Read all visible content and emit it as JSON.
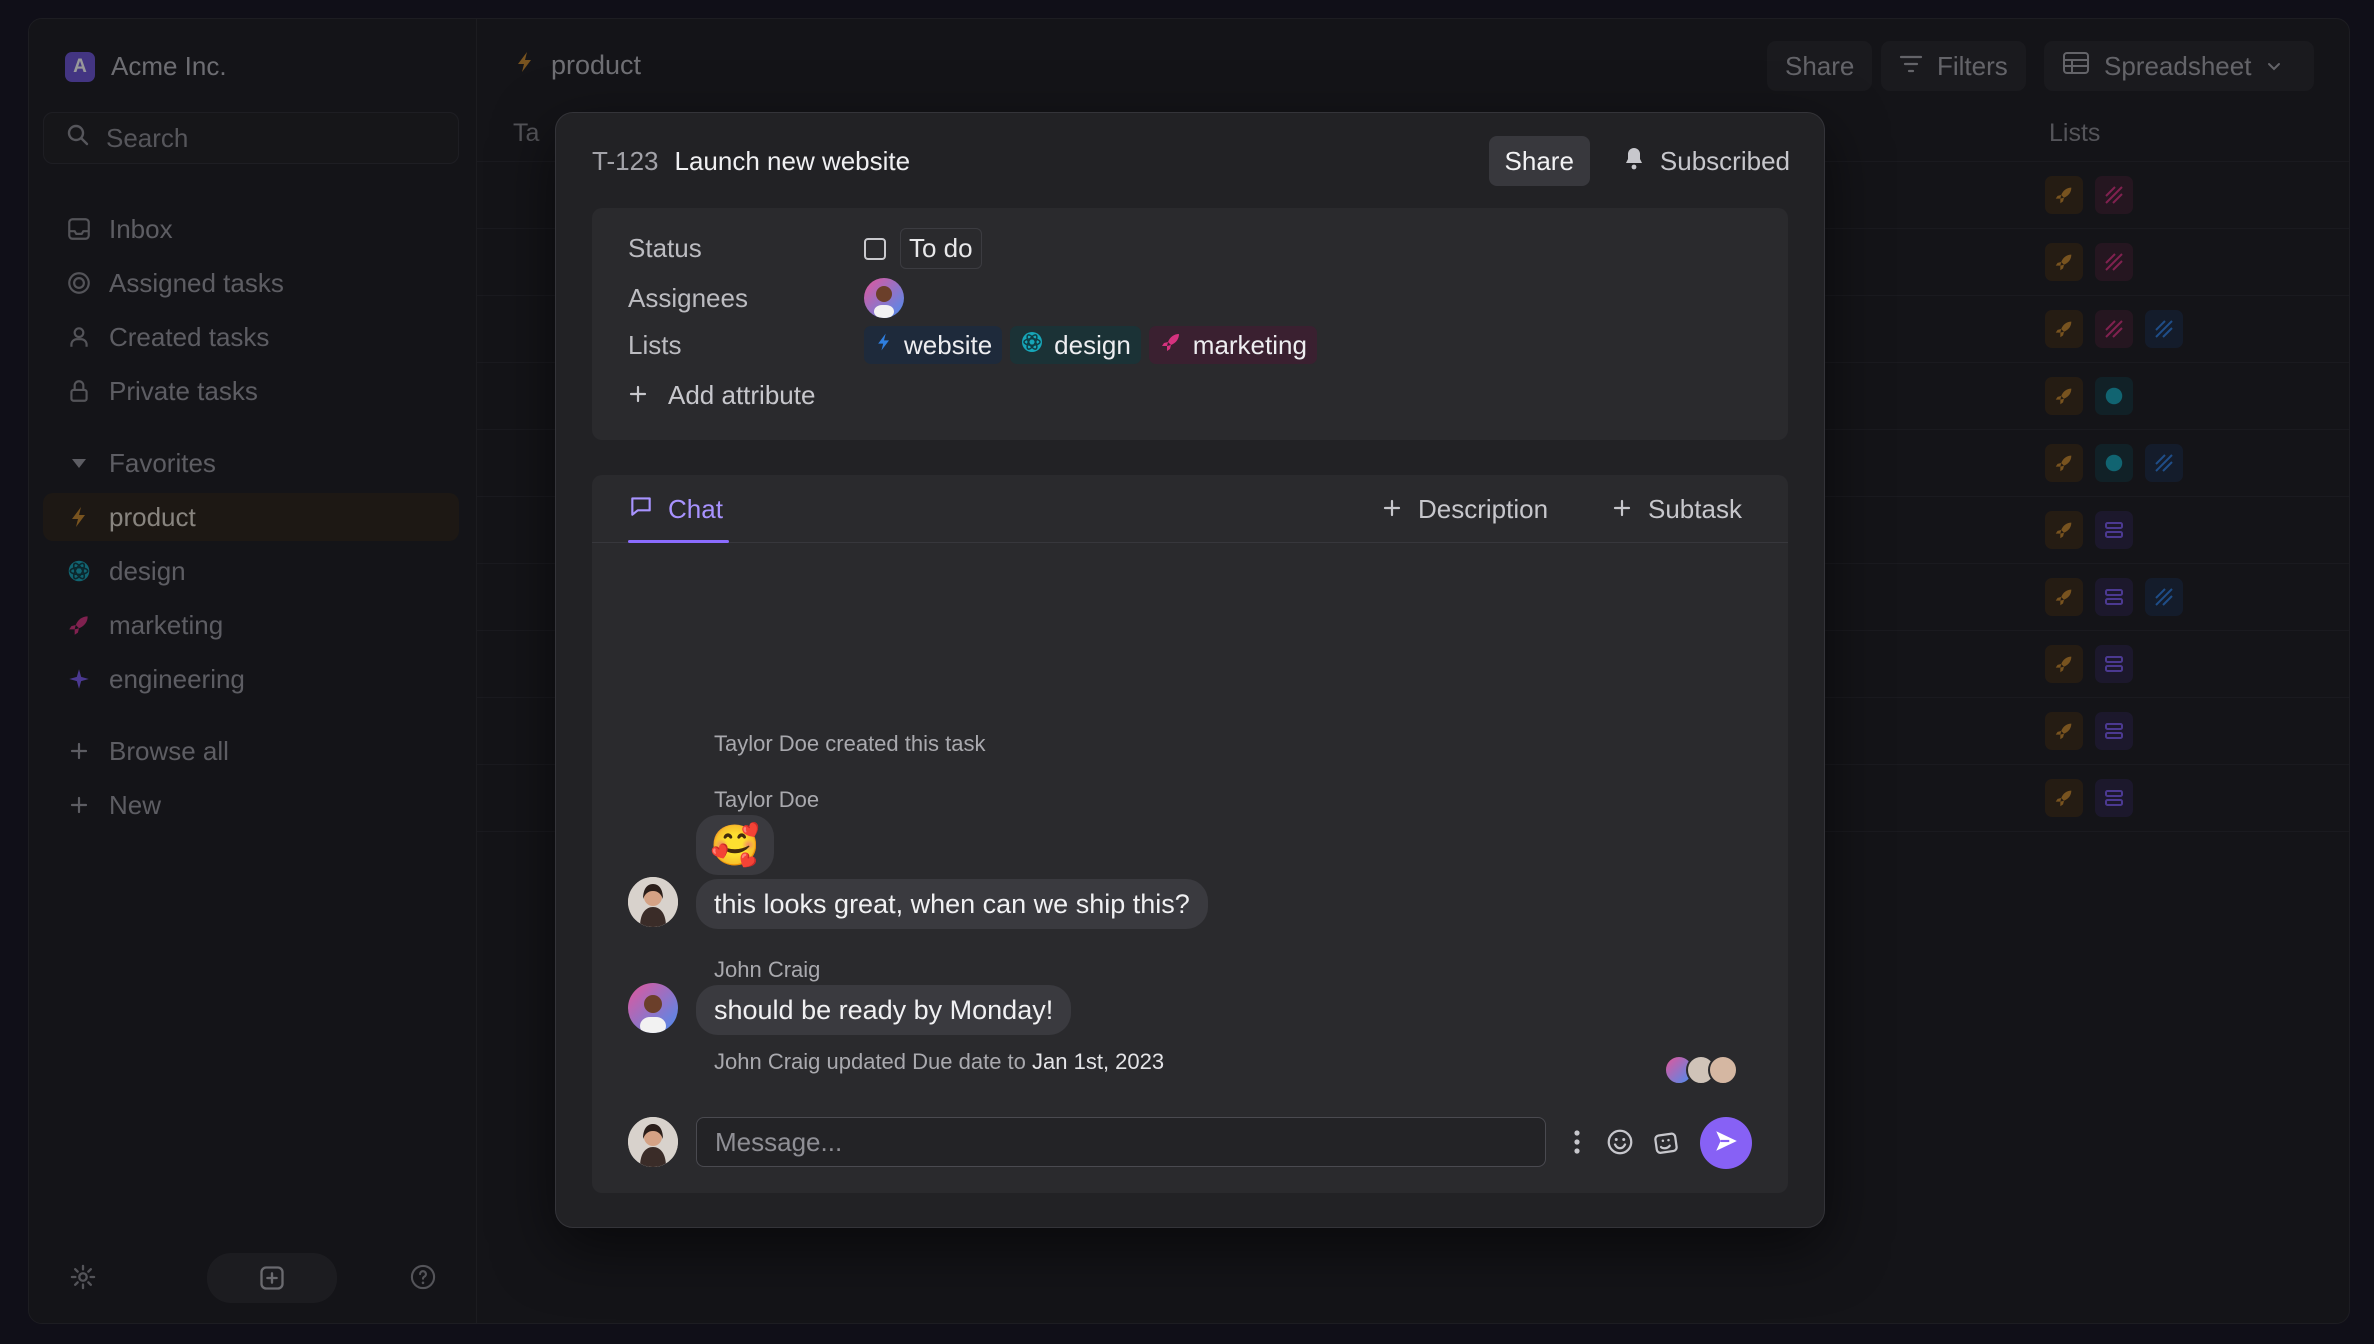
{
  "workspace": {
    "initial": "A",
    "name": "Acme Inc."
  },
  "sidebar": {
    "search_placeholder": "Search",
    "nav": [
      {
        "label": "Inbox",
        "icon": "inbox-icon"
      },
      {
        "label": "Assigned tasks",
        "icon": "target-icon"
      },
      {
        "label": "Created tasks",
        "icon": "user-icon"
      },
      {
        "label": "Private tasks",
        "icon": "lock-icon"
      }
    ],
    "favorites_label": "Favorites",
    "favorites": [
      {
        "label": "product",
        "icon": "bolt-icon",
        "color": "#c9892c"
      },
      {
        "label": "design",
        "icon": "atom-icon",
        "color": "#17a6b8"
      },
      {
        "label": "marketing",
        "icon": "rocket-icon",
        "color": "#d6327f"
      },
      {
        "label": "engineering",
        "icon": "sparkle-icon",
        "color": "#7b5cf0"
      }
    ],
    "browse_all": "Browse all",
    "new": "New"
  },
  "main": {
    "breadcrumb": "product",
    "share": "Share",
    "filters": "Filters",
    "view": "Spreadsheet",
    "col_tasks": "Ta",
    "col_lists": "Lists"
  },
  "task": {
    "id": "T-123",
    "title": "Launch new website",
    "share": "Share",
    "subscribed": "Subscribed",
    "attributes": {
      "status_label": "Status",
      "status_value": "To do",
      "assignees_label": "Assignees",
      "lists_label": "Lists",
      "lists": [
        {
          "label": "website",
          "icon": "bolt-icon",
          "color": "#2f7fe0",
          "bg": "#1e2a3b"
        },
        {
          "label": "design",
          "icon": "atom-icon",
          "color": "#17a6b8",
          "bg": "#1b3236"
        },
        {
          "label": "marketing",
          "icon": "rocket-icon",
          "color": "#d6327f",
          "bg": "#3a2030"
        }
      ],
      "add_attribute": "Add attribute"
    },
    "tabs": {
      "chat": "Chat",
      "description": "Description",
      "subtask": "Subtask"
    },
    "activity": {
      "created": "Taylor Doe created this task",
      "sender1": "Taylor Doe",
      "emoji": "🥰",
      "message1": "this looks great, when can we ship this?",
      "sender2": "John Craig",
      "message2": "should be ready by Monday!",
      "update_prefix": "John Craig updated Due date to",
      "update_value": "Jan 1st, 2023"
    },
    "composer_placeholder": "Message..."
  },
  "colors": {
    "accent": "#8b6cff",
    "product": "#c9892c",
    "design": "#17a6b8",
    "marketing": "#d6327f"
  }
}
